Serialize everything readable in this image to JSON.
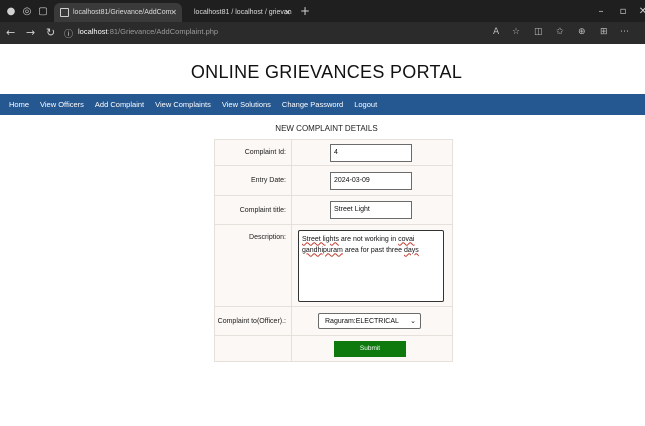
{
  "browser": {
    "tabs": [
      {
        "label": "localhost81/Grievance/AddCom"
      },
      {
        "label": "localhost81 / localhost / grievan"
      }
    ],
    "address": {
      "host": "localhost",
      "path": ":81/Grievance/AddComplaint.php"
    }
  },
  "page": {
    "title": "ONLINE GRIEVANCES PORTAL",
    "nav": [
      "Home",
      "View Officers",
      "Add Complaint",
      "View Complaints",
      "View Solutions",
      "Change Password",
      "Logout"
    ],
    "section_title": "NEW COMPLAINT DETAILS"
  },
  "form": {
    "complaint_id_label": "Complaint Id:",
    "complaint_id_value": "4",
    "entry_date_label": "Entry Date:",
    "entry_date_value": "2024-03-09",
    "complaint_title_label": "Complaint title:",
    "complaint_title_value": "Street Light",
    "description_label": "Description:",
    "description_words": [
      "Street lights",
      " are not working in ",
      "covai",
      "gandhipuram",
      " area for past three ",
      "days"
    ],
    "officer_label": "Complaint to(Officer).:",
    "officer_selected": "Raguram:ELECTRICAL",
    "submit_label": "Submit"
  },
  "icons": {
    "back": "back-arrow-icon",
    "forward": "forward-arrow-icon",
    "refresh": "refresh-icon",
    "info": "site-info-icon"
  }
}
